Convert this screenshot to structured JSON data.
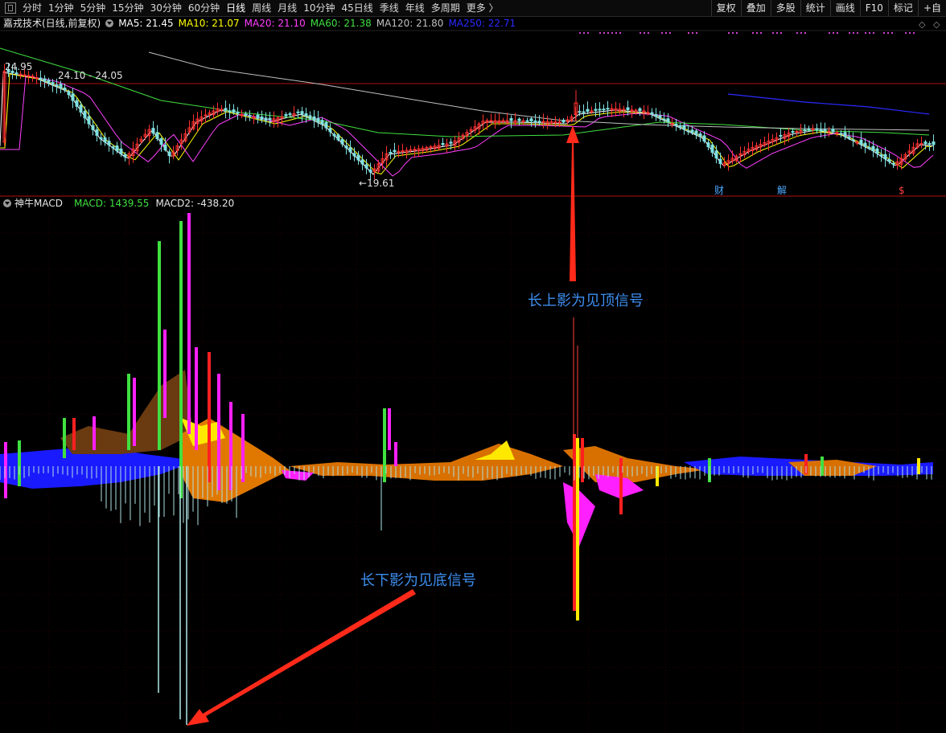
{
  "toolbar": {
    "periods": [
      "分时",
      "1分钟",
      "5分钟",
      "15分钟",
      "30分钟",
      "60分钟",
      "日线",
      "周线",
      "月线",
      "10分钟",
      "45日线",
      "季线",
      "年线",
      "多周期",
      "更多 〉"
    ],
    "active_period": "日线",
    "buttons": [
      "复权",
      "叠加",
      "多股",
      "统计",
      "画线",
      "F10",
      "标记",
      "+自"
    ]
  },
  "info": {
    "title": "嘉戎技术(日线,前复权)",
    "ma5": "MA5: 21.45",
    "ma10": "MA10: 21.07",
    "ma20": "MA20: 21.10",
    "ma60": "MA60: 21.38",
    "ma120": "MA120: 21.80",
    "ma250": "MA250: 22.71"
  },
  "colors": {
    "ma5": "#ffffff",
    "ma10": "#ffff00",
    "ma20": "#ff40ff",
    "ma60": "#40e040",
    "ma120": "#c0c0c0",
    "ma250": "#2a2aff",
    "up": "#ff3030",
    "down": "#7fe0e0",
    "separator": "#b01010",
    "annotation": "#3d8ef0",
    "arrow": "#ff2a1a"
  },
  "chart": {
    "price_high": "24.95",
    "price_range": "24.10 - 24.05",
    "price_low": "19.61",
    "events": [
      "财",
      "解",
      "$"
    ]
  },
  "indicator": {
    "name": "神牛MACD",
    "macd": "MACD: 1439.55",
    "macd2": "MACD2: -438.20"
  },
  "annotations": {
    "top_signal": "长上影为见顶信号",
    "bottom_signal": "长下影为见底信号"
  },
  "icons": {
    "settings": "square-layout-icon",
    "dropdown": "circle-dropdown-icon",
    "diamond": "diamond-icon"
  }
}
